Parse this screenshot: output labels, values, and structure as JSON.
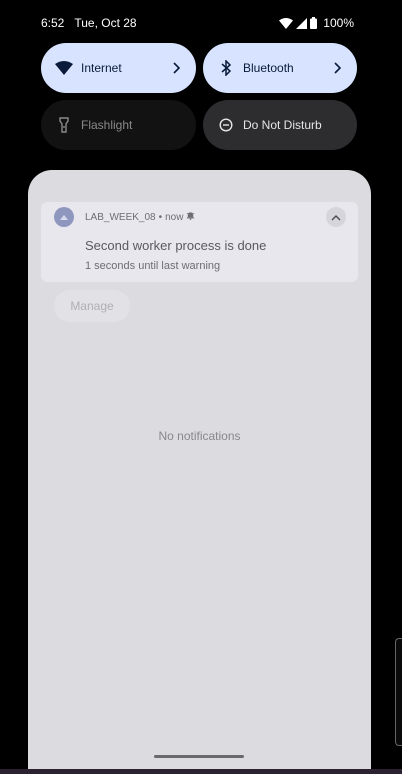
{
  "status_bar": {
    "time": "6:52",
    "date": "Tue, Oct 28",
    "battery": "100%"
  },
  "quick_settings": {
    "tiles": [
      {
        "label": "Internet",
        "icon": "wifi-icon",
        "state": "on"
      },
      {
        "label": "Bluetooth",
        "icon": "bluetooth-icon",
        "state": "on"
      },
      {
        "label": "Flashlight",
        "icon": "flashlight-icon",
        "state": "off"
      },
      {
        "label": "Do Not Disturb",
        "icon": "do-not-disturb-icon",
        "state": "off"
      }
    ]
  },
  "notification": {
    "app_name": "LAB_WEEK_08",
    "separator": "•",
    "time": "now",
    "title": "Second worker process is done",
    "body": "1 seconds until last warning"
  },
  "shade": {
    "manage_label": "Manage",
    "empty_label": "No notifications"
  },
  "colors": {
    "active_tile": "#d7e3ff",
    "shade_bg": "#dcdbe0",
    "notification_bg": "#e9e7ee"
  }
}
